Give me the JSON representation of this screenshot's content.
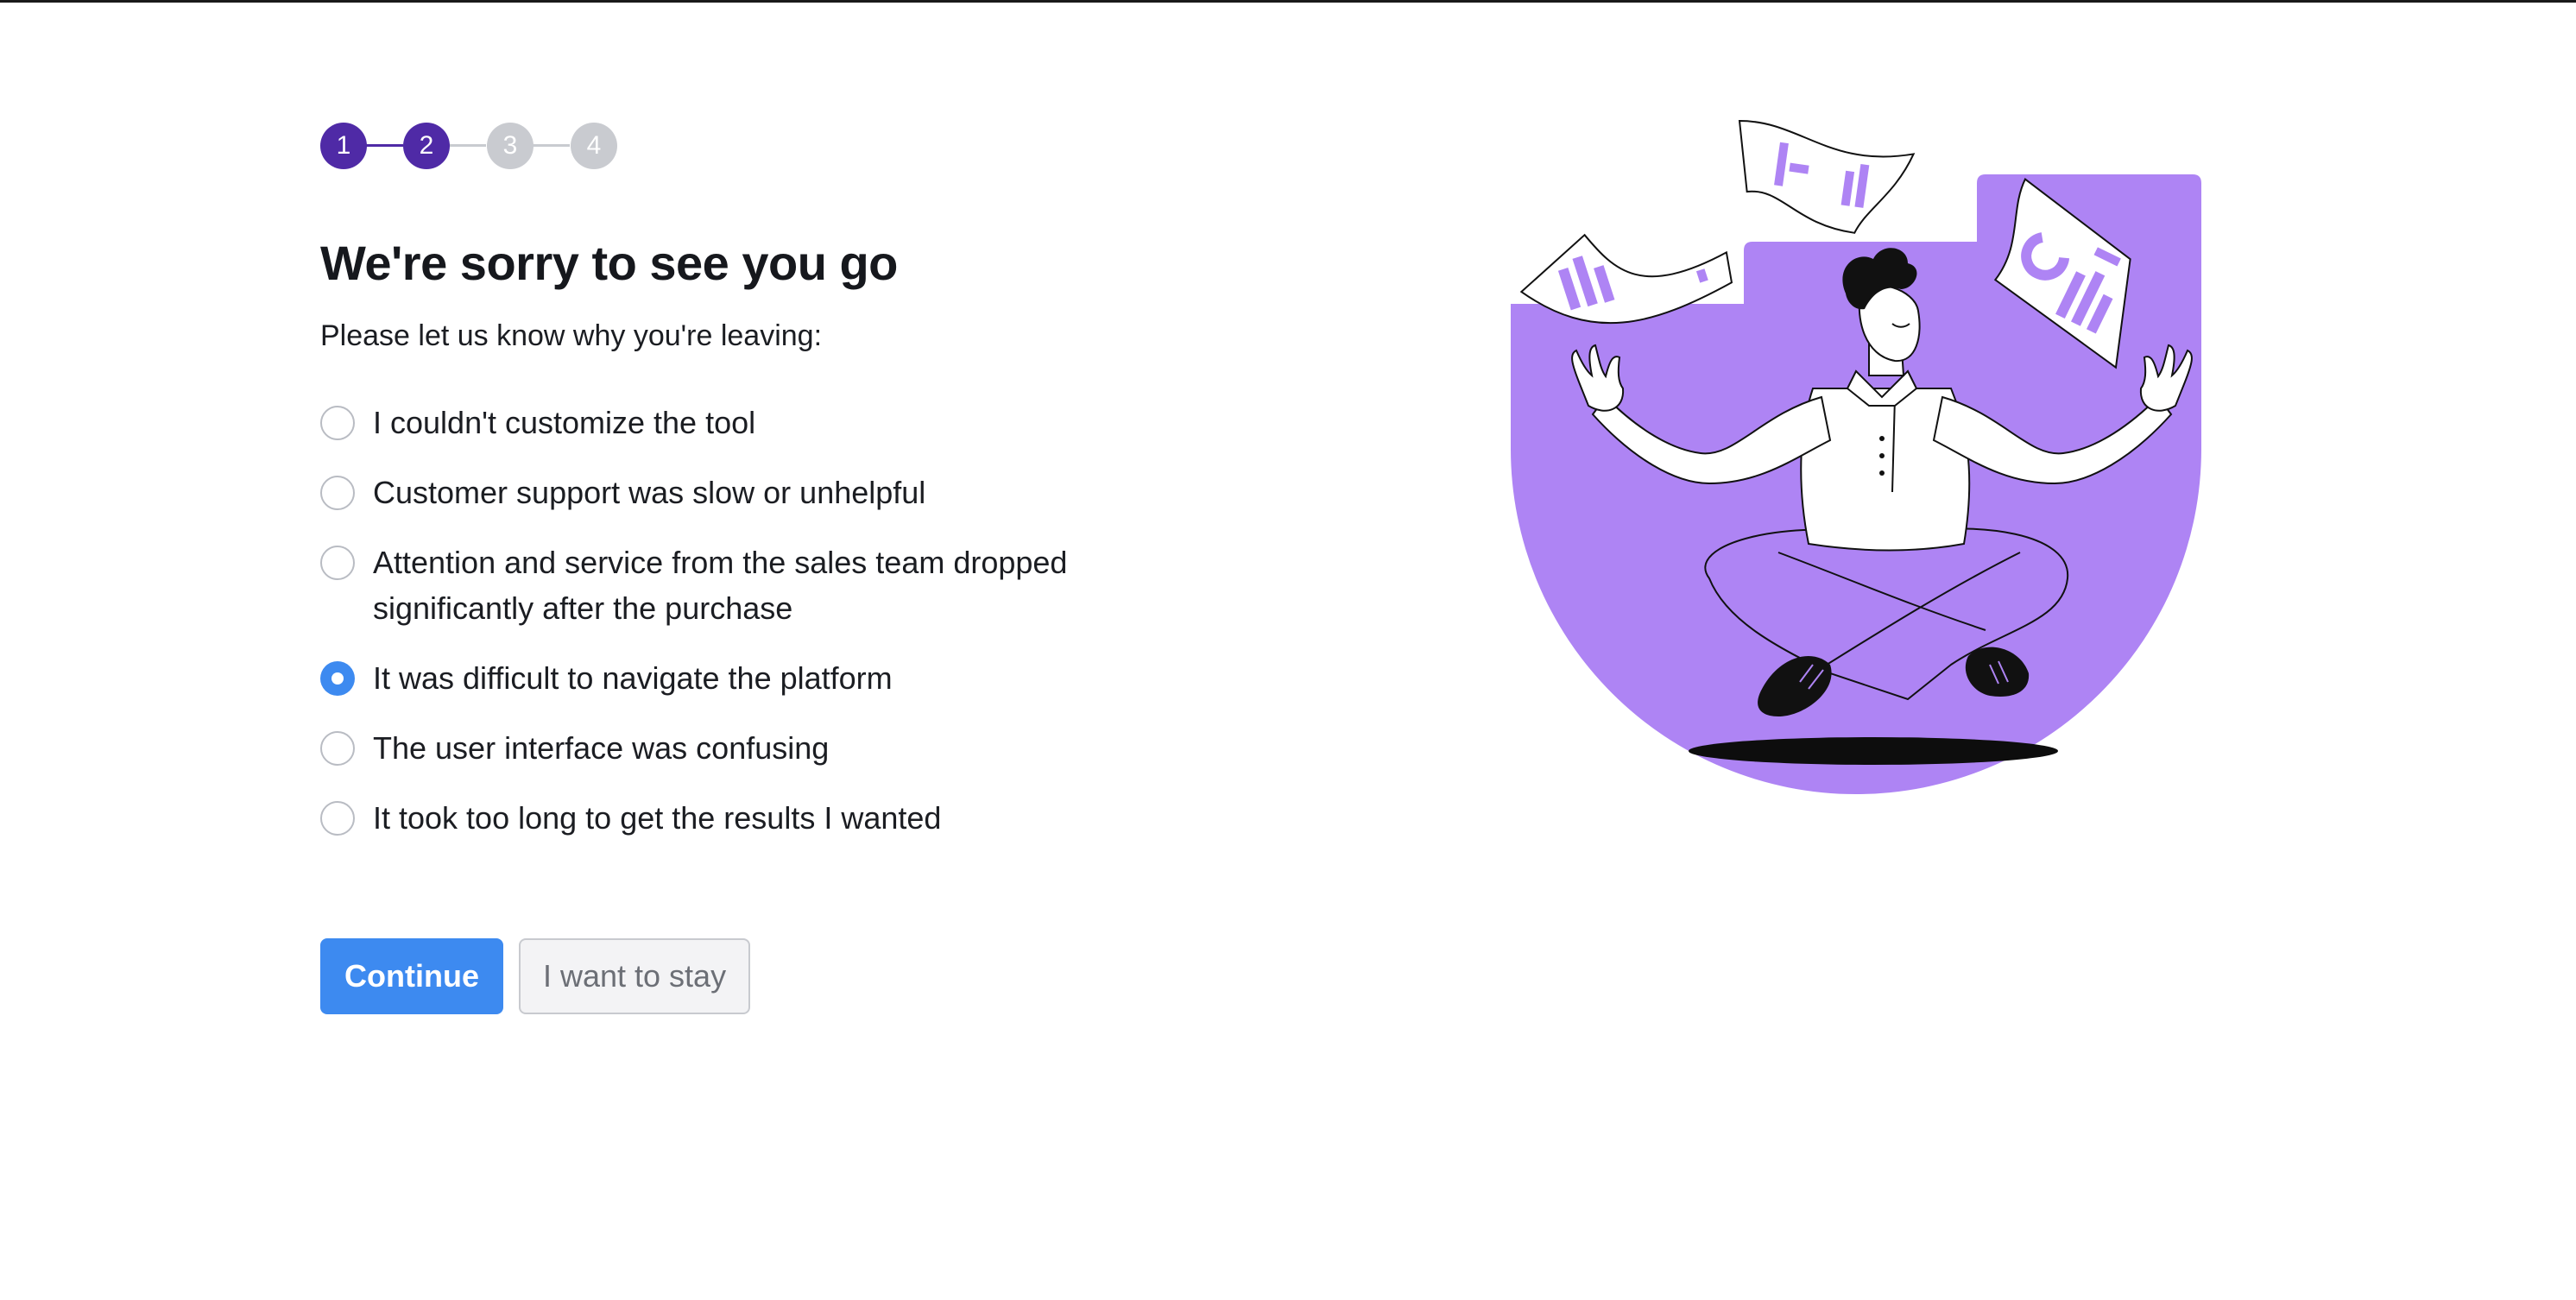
{
  "stepper": {
    "steps": [
      "1",
      "2",
      "3",
      "4"
    ],
    "current_step": 2
  },
  "page": {
    "title": "We're sorry to see you go",
    "subtitle": "Please let us know why you're leaving:"
  },
  "reasons": [
    {
      "label": "I couldn't customize the tool",
      "selected": false
    },
    {
      "label": "Customer support was slow or unhelpful",
      "selected": false
    },
    {
      "label": "Attention and service from the sales team dropped significantly after the purchase",
      "selected": false
    },
    {
      "label": "It was difficult to navigate the platform",
      "selected": true
    },
    {
      "label": "The user interface was confusing",
      "selected": false
    },
    {
      "label": "It took too long to get the results I wanted",
      "selected": false
    }
  ],
  "actions": {
    "continue_label": "Continue",
    "stay_label": "I want to stay"
  },
  "colors": {
    "step_active": "#4f2aa6",
    "step_inactive": "#c9cbd0",
    "primary_button": "#3d8af0",
    "illustration_accent": "#ae84f4"
  },
  "illustration": {
    "icon": "meditating-person-juggling-documents-illustration"
  }
}
